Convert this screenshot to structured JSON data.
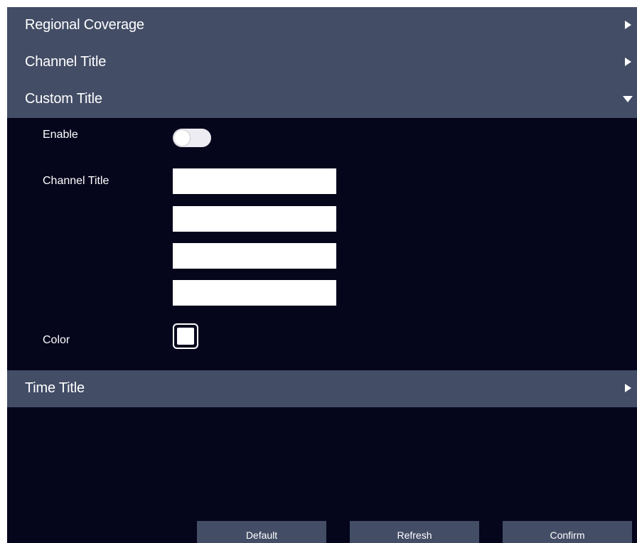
{
  "sections": {
    "regional_coverage": {
      "title": "Regional Coverage",
      "expanded": false
    },
    "channel_title": {
      "title": "Channel Title",
      "expanded": false
    },
    "custom_title": {
      "title": "Custom Title",
      "expanded": true
    },
    "time_title": {
      "title": "Time Title",
      "expanded": false
    }
  },
  "custom_title_form": {
    "enable_label": "Enable",
    "enable_on": false,
    "channel_title_label": "Channel Title",
    "title_lines": [
      "",
      "",
      "",
      ""
    ],
    "color_label": "Color",
    "color_value": "#ffffff"
  },
  "buttons": {
    "default": "Default",
    "refresh": "Refresh",
    "confirm": "Confirm"
  },
  "colors": {
    "background": "#05051c",
    "header": "#434d66",
    "text": "#ffffff"
  },
  "icons": {
    "collapsed": "caret-right-icon",
    "expanded": "caret-down-icon"
  }
}
